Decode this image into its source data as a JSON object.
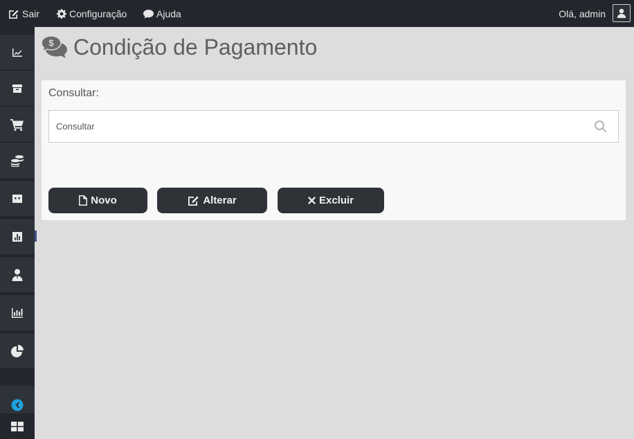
{
  "topbar": {
    "sair_label": "Sair",
    "config_label": "Configuração",
    "ajuda_label": "Ajuda",
    "greeting": "Olá, admin"
  },
  "sidebar": {
    "items": [
      {
        "icon": "line-chart-icon"
      },
      {
        "icon": "box-icon"
      },
      {
        "icon": "shopping-cart-icon"
      },
      {
        "icon": "coins-icon"
      },
      {
        "icon": "card-icon"
      },
      {
        "icon": "bar-chart-icon"
      },
      {
        "icon": "user-tie-icon"
      },
      {
        "icon": "bar-chart-alt-icon"
      },
      {
        "icon": "pie-chart-icon"
      }
    ],
    "collapse_icon": "chevron-left-circle-icon",
    "grid_icon": "windows-grid-icon",
    "accent": "#1fa1e0"
  },
  "page": {
    "title": "Condição de Pagamento",
    "title_icon": "money-chat-icon"
  },
  "search": {
    "label": "Consultar:",
    "placeholder": "Consultar",
    "value": ""
  },
  "actions": {
    "novo": "Novo",
    "alterar": "Alterar",
    "excluir": "Excluir"
  }
}
